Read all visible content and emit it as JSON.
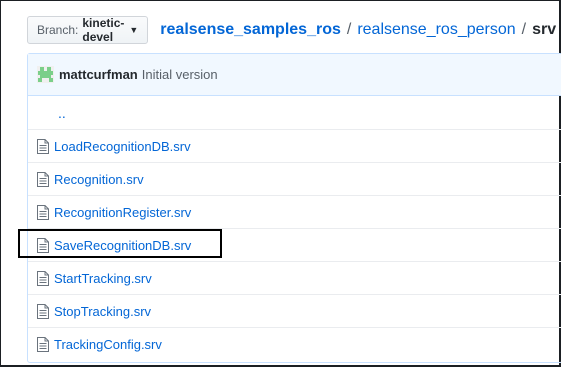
{
  "branch": {
    "prefix": "Branch:",
    "name": "kinetic-devel"
  },
  "breadcrumb": {
    "root": "realsense_samples_ros",
    "separator": "/",
    "middle": "realsense_ros_person",
    "current": "srv"
  },
  "commit": {
    "author": "mattcurfman",
    "message": "Initial version"
  },
  "parent_dir": "..",
  "files": [
    {
      "name": "LoadRecognitionDB.srv",
      "icon": "file-icon"
    },
    {
      "name": "Recognition.srv",
      "icon": "file-icon"
    },
    {
      "name": "RecognitionRegister.srv",
      "icon": "file-icon"
    },
    {
      "name": "SaveRecognitionDB.srv",
      "icon": "file-icon"
    },
    {
      "name": "StartTracking.srv",
      "icon": "file-icon"
    },
    {
      "name": "StopTracking.srv",
      "icon": "file-icon"
    },
    {
      "name": "TrackingConfig.srv",
      "icon": "file-icon"
    }
  ],
  "colors": {
    "link": "#0366d6",
    "commit_bar_bg": "#f1f8ff",
    "avatar": "#7bcf8a",
    "highlight_border": "#000000"
  }
}
